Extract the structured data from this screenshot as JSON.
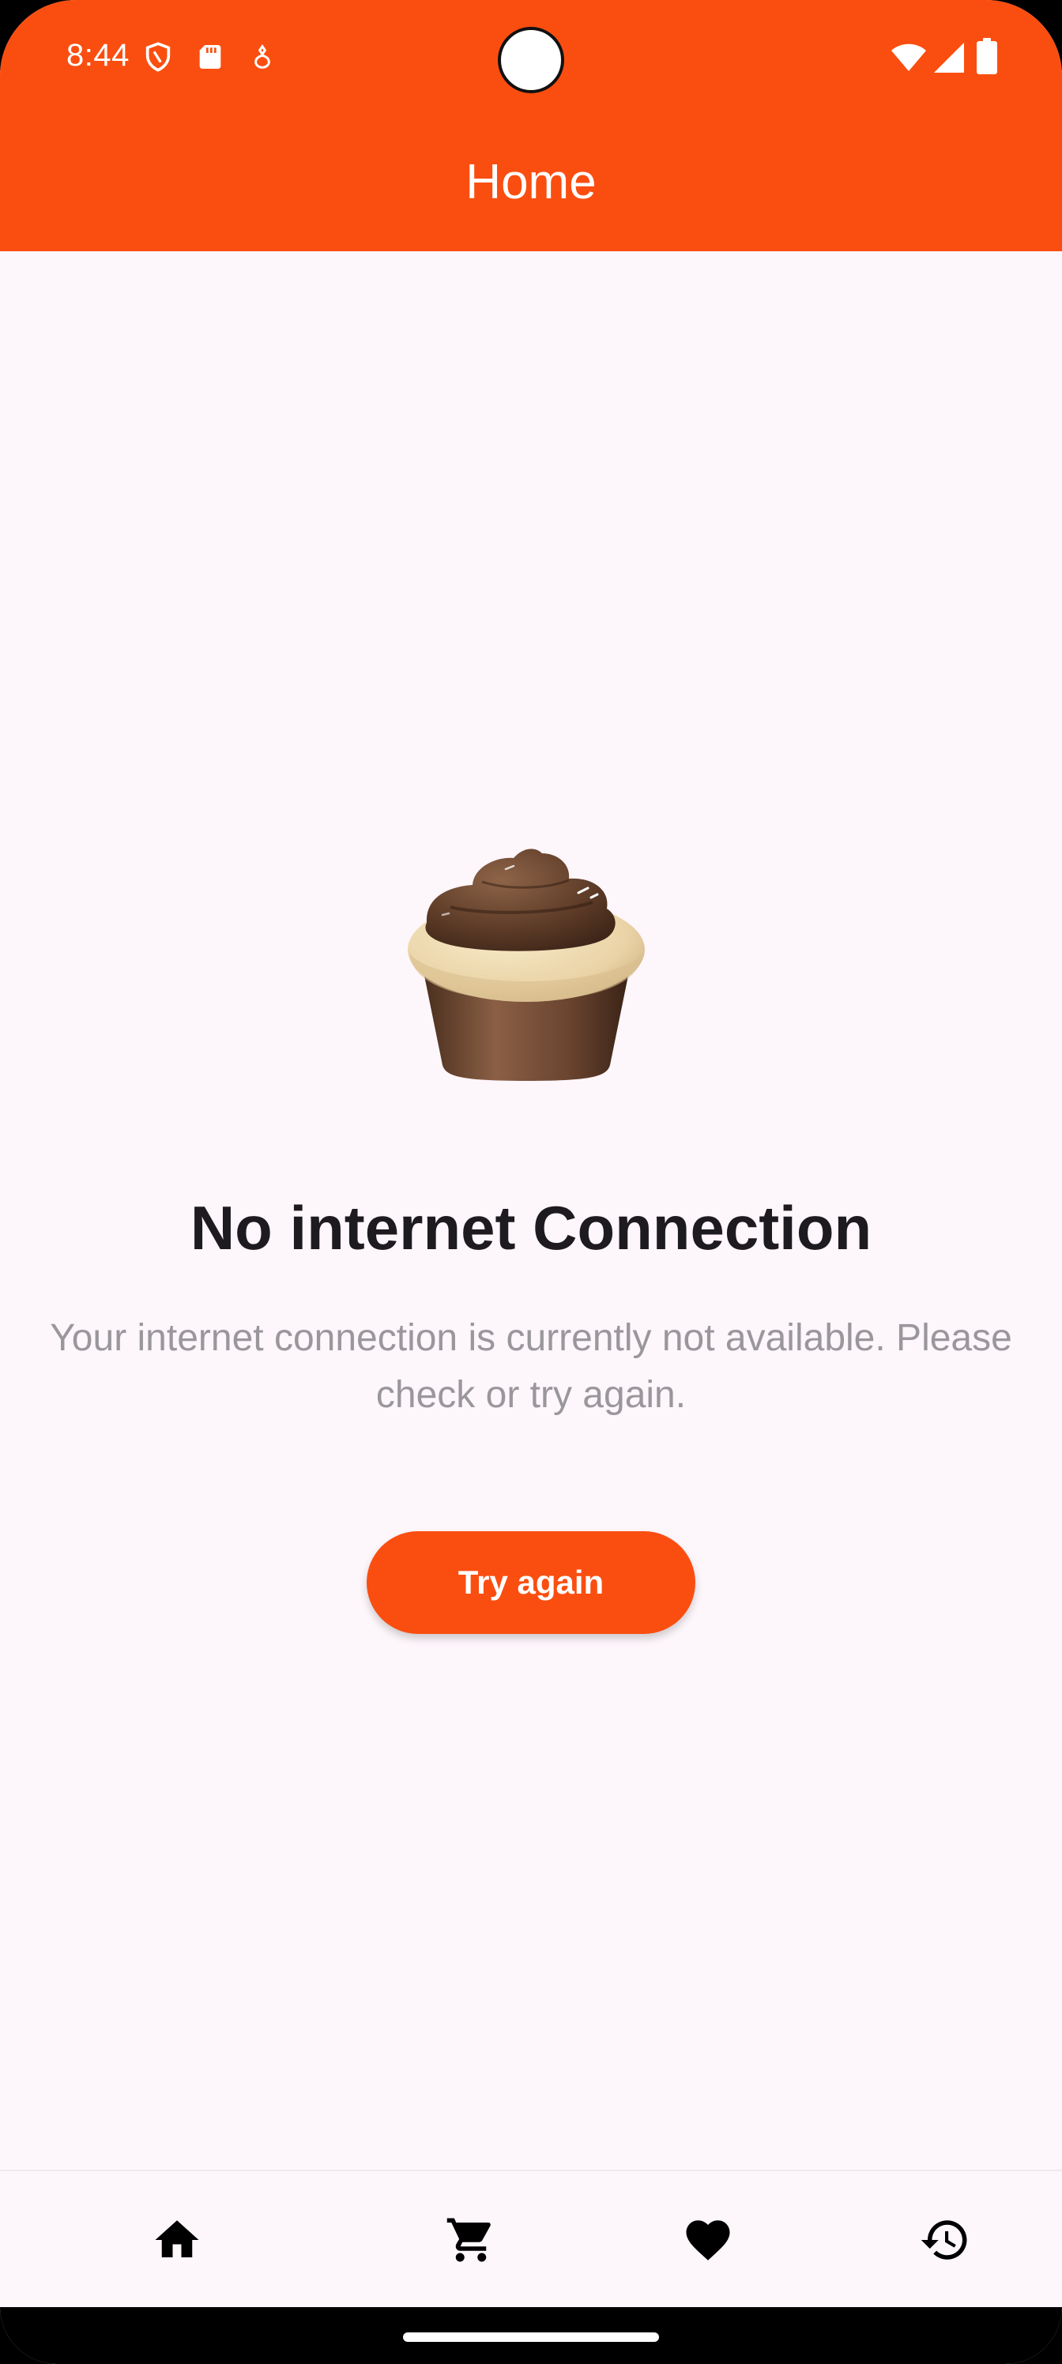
{
  "status_bar": {
    "time": "8:44",
    "left_icons": [
      "shield-icon",
      "sd-card-icon",
      "notification-icon"
    ],
    "right_icons": [
      "wifi-icon",
      "cellular-signal-icon",
      "battery-icon"
    ]
  },
  "app_bar": {
    "title": "Home"
  },
  "empty_state": {
    "illustration": "cupcake-illustration",
    "title": "No internet Connection",
    "message": "Your internet connection is currently not available. Please check or try again.",
    "button_label": "Try again"
  },
  "bottom_nav": {
    "items": [
      {
        "icon": "home-icon"
      },
      {
        "icon": "cart-icon"
      },
      {
        "icon": "heart-icon"
      },
      {
        "icon": "history-icon"
      }
    ]
  },
  "colors": {
    "accent": "#FA4E10",
    "background": "#FDF6FB",
    "headline": "#1E1B20",
    "message": "#9A979C"
  }
}
